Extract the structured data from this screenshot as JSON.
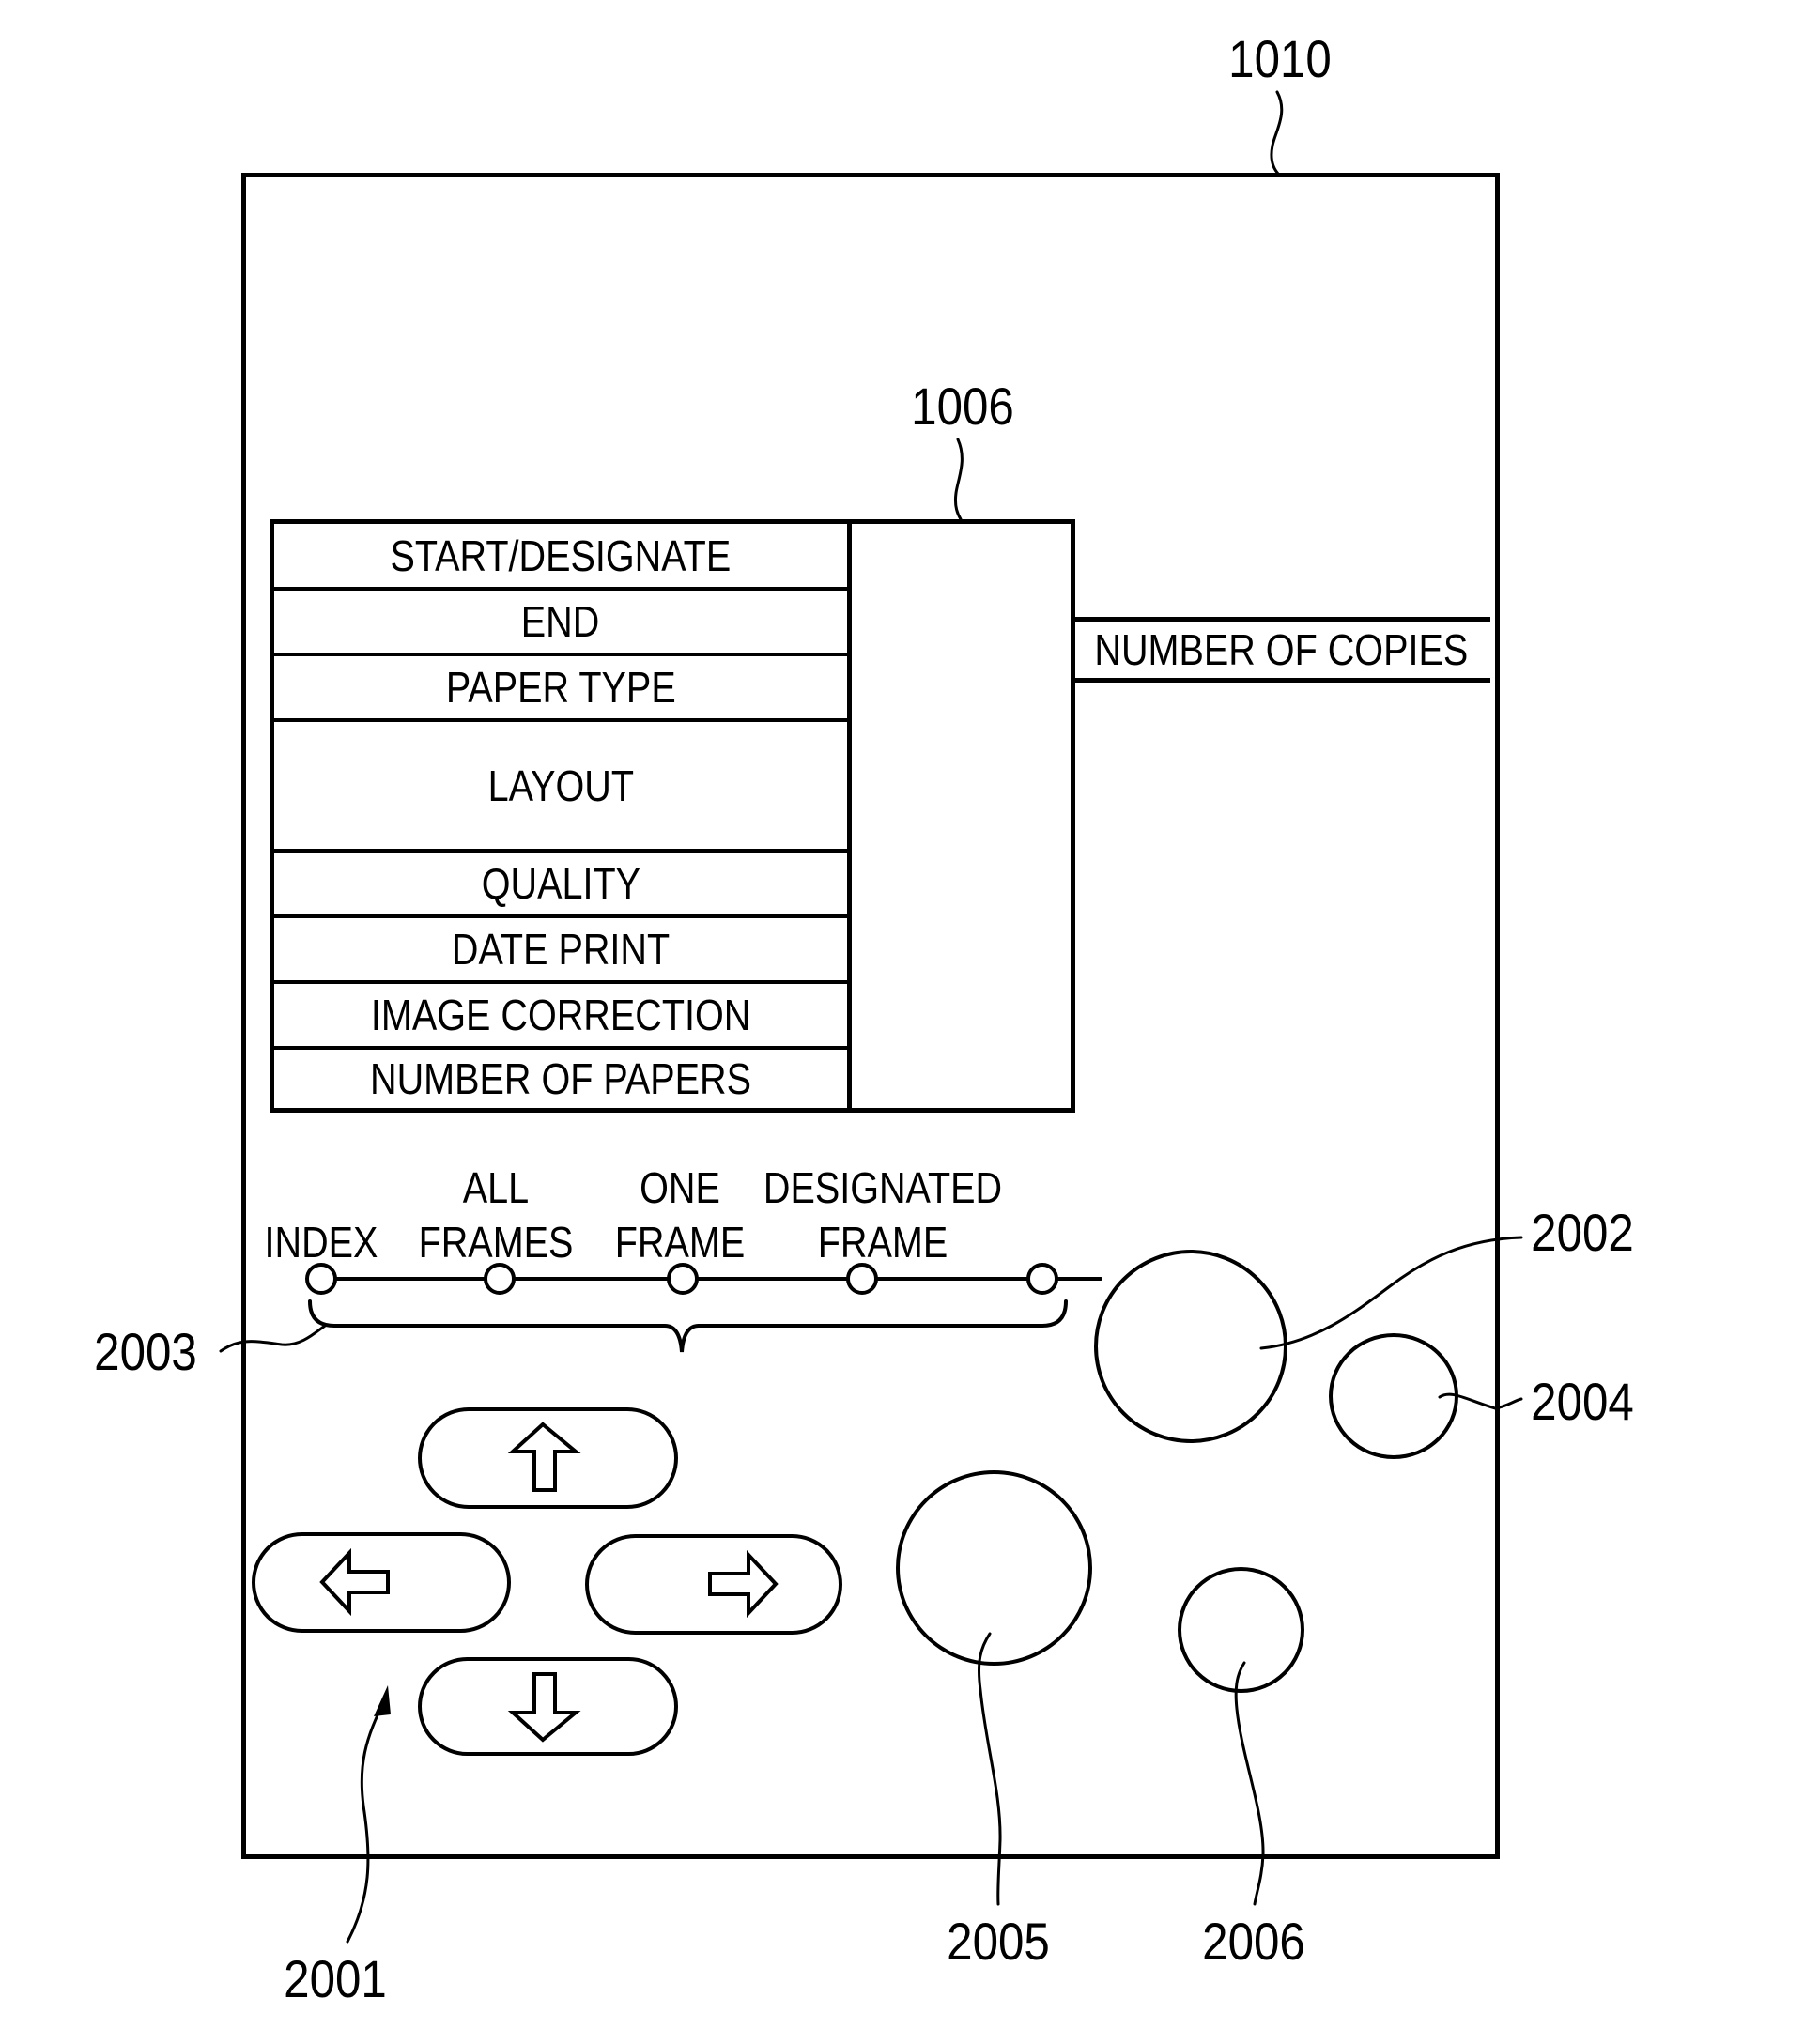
{
  "figure": {
    "reference_numerals": {
      "panel": "1010",
      "display": "1006",
      "cross_keys": "2001",
      "mode_dial_button": "2002",
      "mode_selector": "2003",
      "button_2004": "2004",
      "button_2005": "2005",
      "button_2006": "2006"
    }
  },
  "menu": {
    "items": [
      {
        "label": "START/DESIGNATE"
      },
      {
        "label": "END"
      },
      {
        "label": "PAPER TYPE"
      },
      {
        "label": "LAYOUT"
      },
      {
        "label": "QUALITY"
      },
      {
        "label": "DATE PRINT"
      },
      {
        "label": "IMAGE CORRECTION"
      },
      {
        "label": "NUMBER OF PAPERS"
      }
    ],
    "side_item": {
      "label": "NUMBER OF COPIES"
    }
  },
  "mode_selector": {
    "options": [
      {
        "line1": "",
        "line2": "INDEX"
      },
      {
        "line1": "ALL",
        "line2": "FRAMES"
      },
      {
        "line1": "ONE",
        "line2": "FRAME"
      },
      {
        "line1": "DESIGNATED",
        "line2": "FRAME"
      },
      {
        "line1": "",
        "line2": ""
      }
    ]
  },
  "cross_keys": {
    "up": {
      "icon": "arrow-up-outline"
    },
    "left": {
      "icon": "arrow-left-outline"
    },
    "right": {
      "icon": "arrow-right-outline"
    },
    "down": {
      "icon": "arrow-down-outline"
    }
  },
  "colors": {
    "line": "#000000",
    "background": "#ffffff"
  }
}
